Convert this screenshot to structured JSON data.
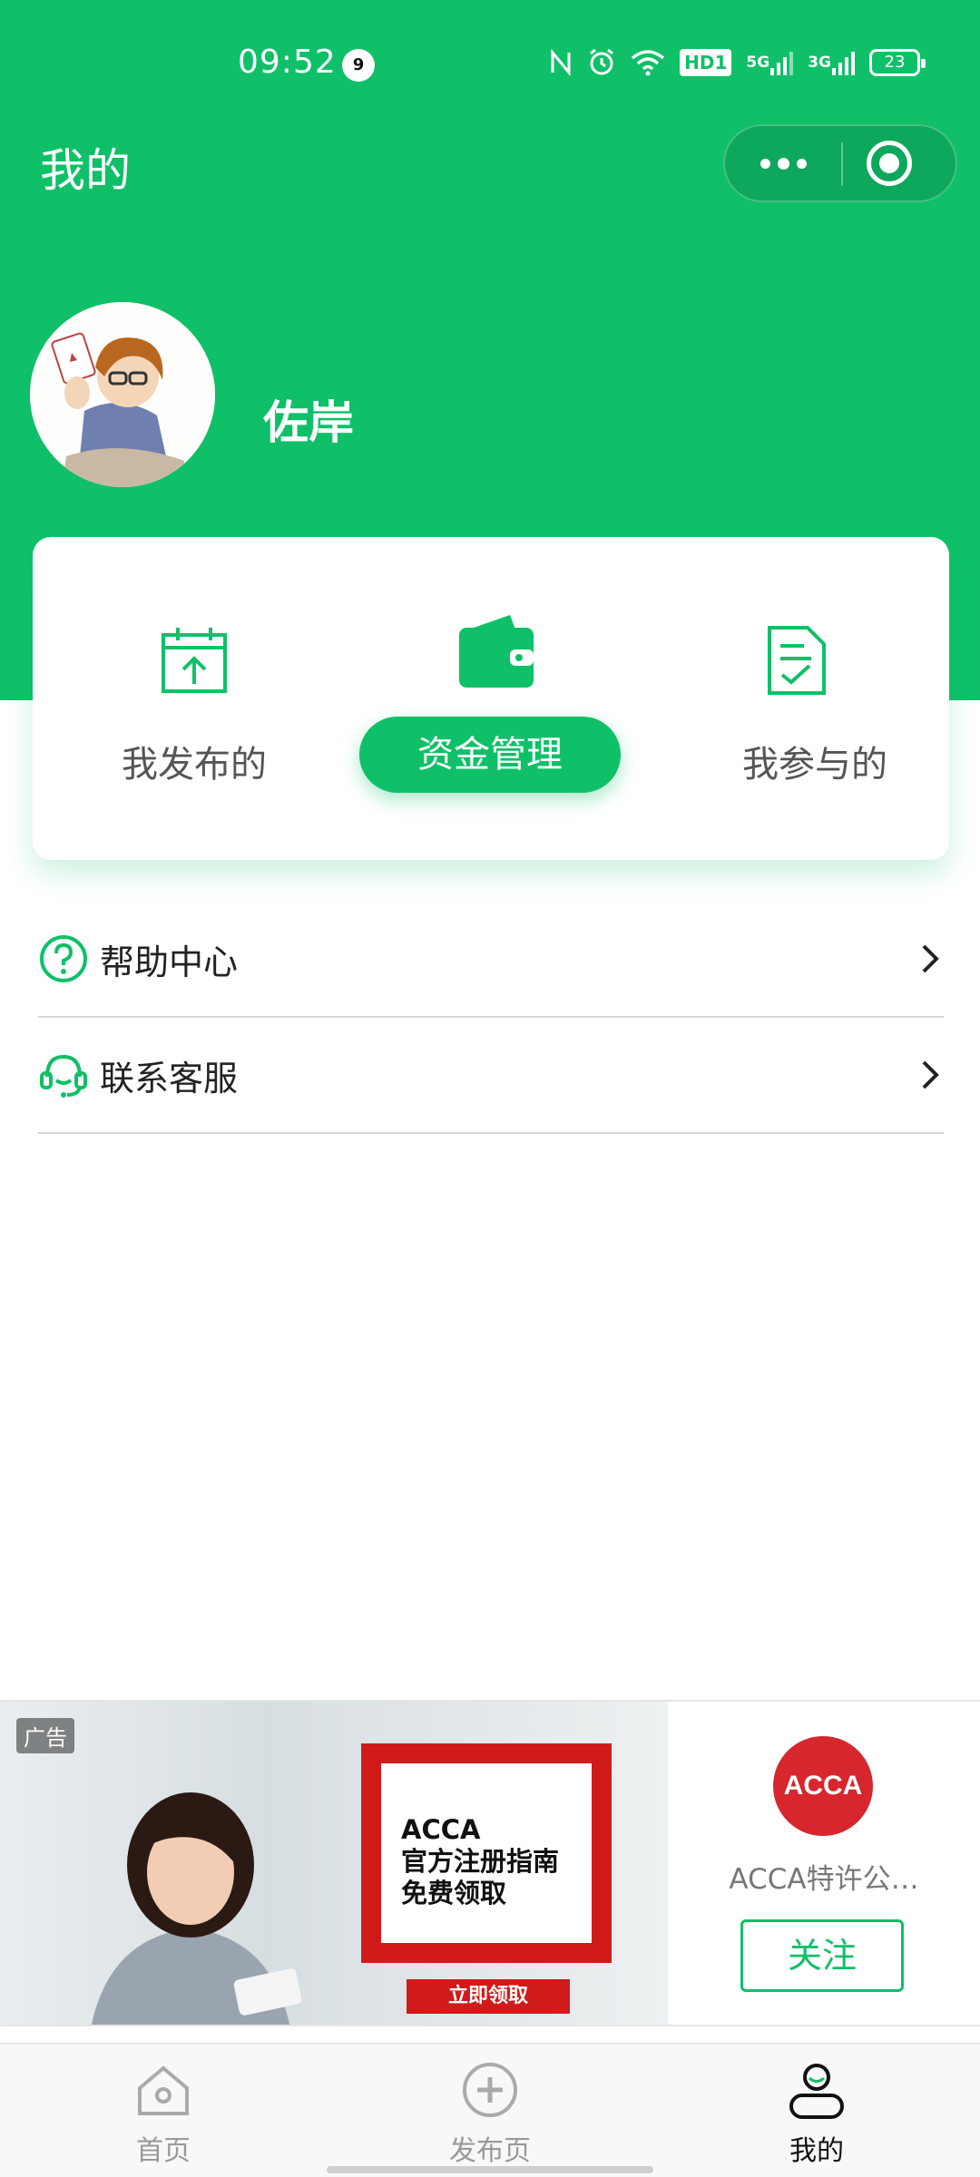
{
  "status_bar": {
    "time": "09:52",
    "notification_count": "9",
    "network_badge": "HD1",
    "signal_1": "5G",
    "signal_2": "3G",
    "battery": "23"
  },
  "nav": {
    "title": "我的"
  },
  "profile": {
    "username": "佐岸"
  },
  "actions": [
    {
      "label": "我发布的",
      "icon": "calendar-upload-icon",
      "active": false
    },
    {
      "label": "资金管理",
      "icon": "wallet-icon",
      "active": true
    },
    {
      "label": "我参与的",
      "icon": "document-check-icon",
      "active": false
    }
  ],
  "menu": [
    {
      "label": "帮助中心",
      "icon": "help-circle-icon"
    },
    {
      "label": "联系客服",
      "icon": "customer-service-icon"
    }
  ],
  "ad": {
    "tag": "广告",
    "headline_1": "ACCA",
    "headline_2": "官方注册指南",
    "headline_3": "免费领取",
    "cta": "立即领取",
    "logo_text": "ACCA",
    "advertiser": "ACCA特许公…",
    "follow_label": "关注"
  },
  "tabs": [
    {
      "label": "首页",
      "icon": "home-icon",
      "active": false
    },
    {
      "label": "发布页",
      "icon": "plus-circle-icon",
      "active": false
    },
    {
      "label": "我的",
      "icon": "user-icon",
      "active": true
    }
  ],
  "colors": {
    "brand_green": "#0fc068",
    "ad_red": "#d11a1a",
    "acca_red": "#d7262d"
  }
}
